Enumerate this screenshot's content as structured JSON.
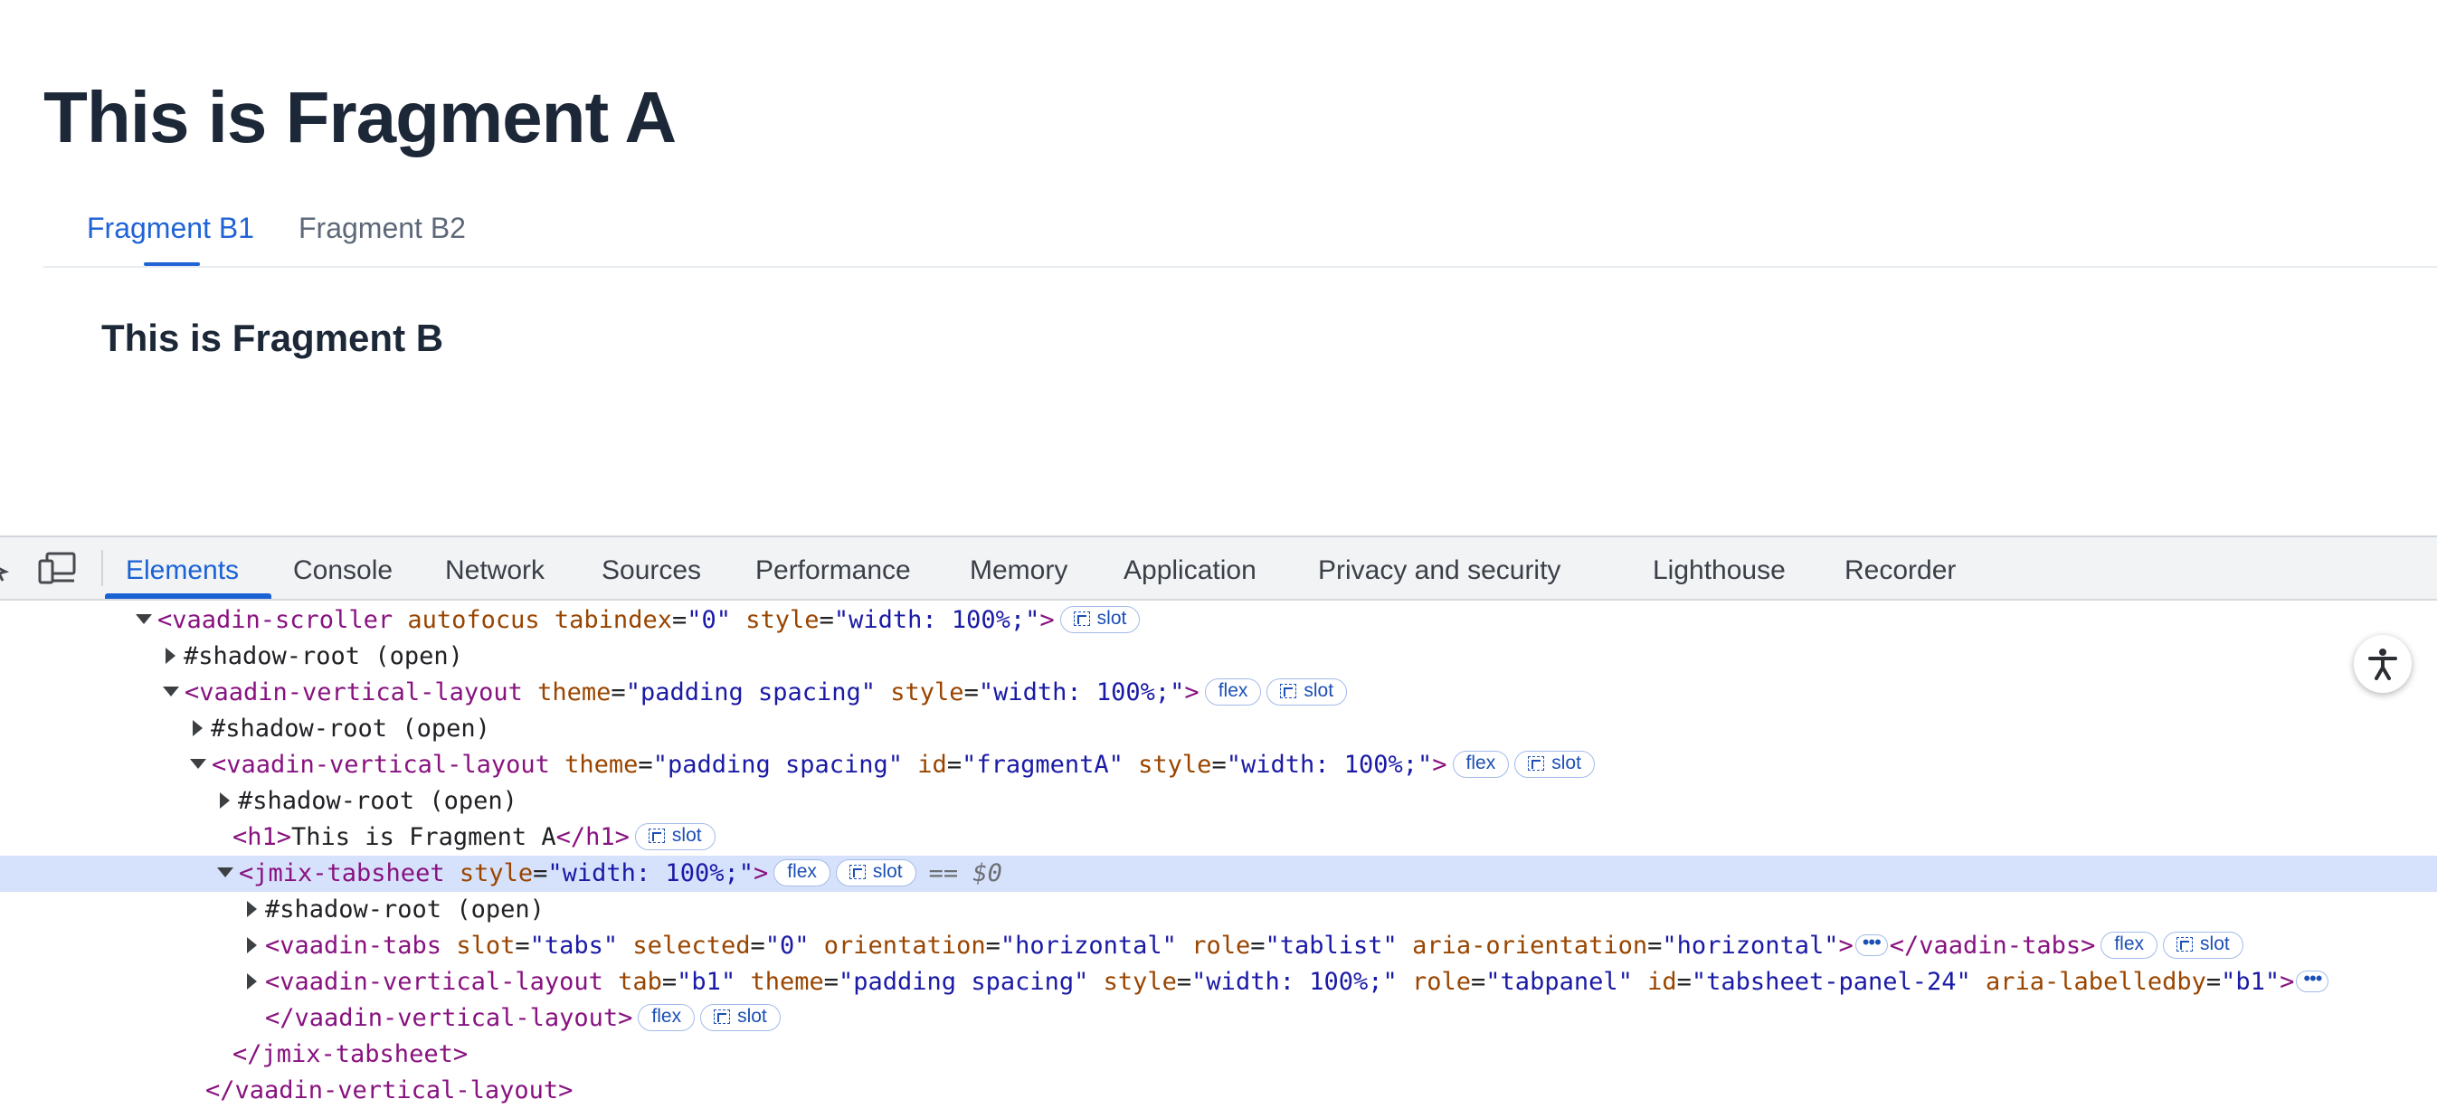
{
  "app": {
    "title": "This is Fragment A",
    "tabs": [
      {
        "label": "Fragment B1",
        "selected": true
      },
      {
        "label": "Fragment B2",
        "selected": false
      }
    ],
    "content_title": "This is Fragment B"
  },
  "devtools": {
    "tabs": [
      "Elements",
      "Console",
      "Network",
      "Sources",
      "Performance",
      "Memory",
      "Application",
      "Privacy and security",
      "Lighthouse",
      "Recorder"
    ],
    "active_tab": "Elements",
    "badges": {
      "flex": "flex",
      "slot": "slot"
    },
    "selected_marker": "== ",
    "selected_var": "$0",
    "lines": {
      "l0": {
        "tag_open": "<vaadin-scroller",
        "a1": " autofocus",
        "a2": " tabindex",
        "eq1": "=",
        "v2": "\"0\"",
        "a3": " style",
        "v3": "\"width: 100%;\"",
        "close": ">"
      },
      "l1": {
        "text": "#shadow-root (open)"
      },
      "l2": {
        "tag_open": "<vaadin-vertical-layout",
        "a1": " theme",
        "v1": "\"padding spacing\"",
        "a2": " style",
        "v2": "\"width: 100%;\"",
        "close": ">"
      },
      "l3": {
        "text": "#shadow-root (open)"
      },
      "l4": {
        "tag_open": "<vaadin-vertical-layout",
        "a1": " theme",
        "v1": "\"padding spacing\"",
        "a2": " id",
        "v2": "\"fragmentA\"",
        "a3": " style",
        "v3": "\"width: 100%;\"",
        "close": ">"
      },
      "l5": {
        "text": "#shadow-root (open)"
      },
      "l6": {
        "open": "<h1>",
        "text": "This is Fragment A",
        "close": "</h1>"
      },
      "l7": {
        "tag_open": "<jmix-tabsheet",
        "a1": " style",
        "v1": "\"width: 100%;\"",
        "close": ">"
      },
      "l8": {
        "text": "#shadow-root (open)"
      },
      "l9": {
        "tag_open": "<vaadin-tabs",
        "a1": " slot",
        "v1": "\"tabs\"",
        "a2": " selected",
        "v2": "\"0\"",
        "a3": " orientation",
        "v3": "\"horizontal\"",
        "a4": " role",
        "v4": "\"tablist\"",
        "a5": " aria-orientation",
        "v5": "\"horizontal\"",
        "close": ">",
        "end_tag": "</vaadin-tabs>"
      },
      "l10": {
        "tag_open": "<vaadin-vertical-layout",
        "a1": " tab",
        "v1": "\"b1\"",
        "a2": " theme",
        "v2": "\"padding spacing\"",
        "a3": " style",
        "v3": "\"width: 100%;\"",
        "a4": " role",
        "v4": "\"tabpanel\"",
        "a5": " id",
        "v5": "\"tabsheet-panel-24\"",
        "a6": " aria-labelledby",
        "v6": "\"b1\"",
        "close": ">"
      },
      "l11": {
        "end_tag": "</vaadin-vertical-layout>"
      },
      "l12": {
        "end_tag": "</jmix-tabsheet>"
      },
      "l13": {
        "end_tag": "</vaadin-vertical-layout>"
      }
    }
  },
  "colors": {
    "accent": "#1f63d6",
    "heading": "#1c2737",
    "tag": "#881280",
    "attr": "#994500",
    "value": "#1a1aa6",
    "selected_row": "#d6e2fb"
  },
  "icons": {
    "inspect": "inspect-element-icon",
    "device": "device-toolbar-icon",
    "accessibility": "accessibility-icon"
  }
}
